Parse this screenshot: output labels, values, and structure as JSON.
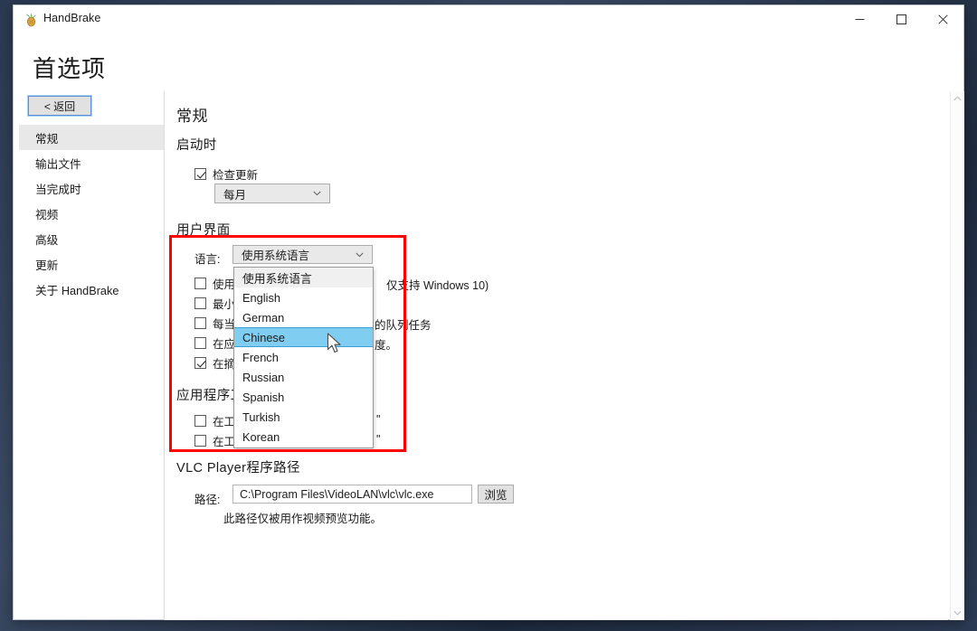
{
  "window": {
    "title": "HandBrake",
    "icon": "handbrake-pineapple-icon",
    "controls": {
      "minimize": "minimize-icon",
      "maximize": "maximize-icon",
      "close": "close-icon"
    }
  },
  "page": {
    "title": "首选项",
    "back_button": "< 返回"
  },
  "sidebar": {
    "items": [
      {
        "label": "常规",
        "active": true
      },
      {
        "label": "输出文件",
        "active": false
      },
      {
        "label": "当完成时",
        "active": false
      },
      {
        "label": "视频",
        "active": false
      },
      {
        "label": "高级",
        "active": false
      },
      {
        "label": "更新",
        "active": false
      },
      {
        "label": "关于 HandBrake",
        "active": false
      }
    ]
  },
  "content": {
    "heading": "常规",
    "startup": {
      "heading": "启动时",
      "check_updates_label": "检查更新",
      "check_updates_checked": true,
      "frequency_value": "每月"
    },
    "ui": {
      "heading": "用户界面",
      "language_label": "语言:",
      "language_value": "使用系统语言",
      "options": [
        {
          "label": "使用系统语言",
          "state": "header"
        },
        {
          "label": "English",
          "state": "normal"
        },
        {
          "label": "German",
          "state": "normal"
        },
        {
          "label": "Chinese",
          "state": "selected"
        },
        {
          "label": "French",
          "state": "normal"
        },
        {
          "label": "Russian",
          "state": "normal"
        },
        {
          "label": "Spanish",
          "state": "normal"
        },
        {
          "label": "Turkish",
          "state": "normal"
        },
        {
          "label": "Korean",
          "state": "normal"
        }
      ],
      "checkboxes": [
        {
          "prefix": "使用",
          "suffix": "仅支持 Windows 10)",
          "checked": false
        },
        {
          "prefix": "最小",
          "suffix": "",
          "checked": false
        },
        {
          "prefix": "每当",
          "suffix": "的队列任务",
          "checked": false
        },
        {
          "prefix": "在应",
          "suffix": "度。",
          "checked": false
        },
        {
          "prefix": "在摘",
          "suffix": "",
          "checked": true
        }
      ]
    },
    "tray": {
      "heading": "应用程序工",
      "checkboxes": [
        {
          "prefix": "在工",
          "suffix": "\"",
          "checked": false
        },
        {
          "prefix": "在工",
          "suffix": "\"",
          "checked": false
        }
      ]
    },
    "vlc": {
      "heading": "VLC Player程序路径",
      "path_label": "路径:",
      "path_value": "C:\\Program Files\\VideoLAN\\vlc\\vlc.exe",
      "browse_label": "浏览",
      "hint": "此路径仅被用作视频预览功能。"
    }
  },
  "annotation": {
    "color": "#ff0000"
  },
  "scrollbar": {
    "up_icon": "chevron-up-icon",
    "down_icon": "chevron-down-icon"
  }
}
